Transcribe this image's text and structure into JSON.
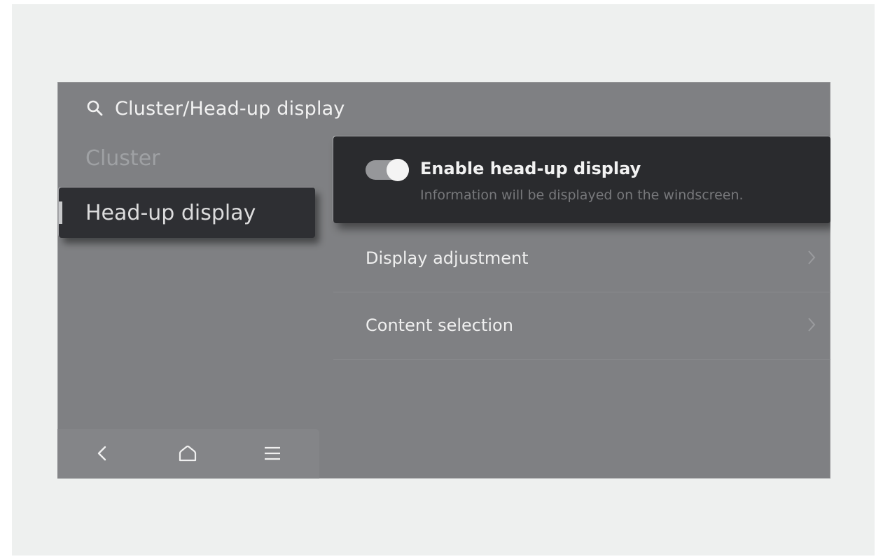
{
  "header": {
    "icon": "search-icon",
    "title": "Cluster/Head-up display"
  },
  "sidebar": {
    "items": [
      {
        "label": "Cluster",
        "active": false
      },
      {
        "label": "Head-up display",
        "active": true
      }
    ]
  },
  "settings": {
    "enable_hud": {
      "label": "Enable head-up display",
      "description": "Information will be displayed on the windscreen.",
      "enabled": true
    },
    "rows": [
      {
        "label": "Display adjustment",
        "icon": "chevron-right-icon"
      },
      {
        "label": "Content selection",
        "icon": "chevron-right-icon"
      }
    ]
  },
  "navbar": {
    "icons": [
      "back-icon",
      "home-icon",
      "menu-icon"
    ]
  },
  "colors": {
    "screen_bg": "#7f8083",
    "active_card_bg": "#2a2b2e",
    "page_bg": "#eef0ef"
  }
}
